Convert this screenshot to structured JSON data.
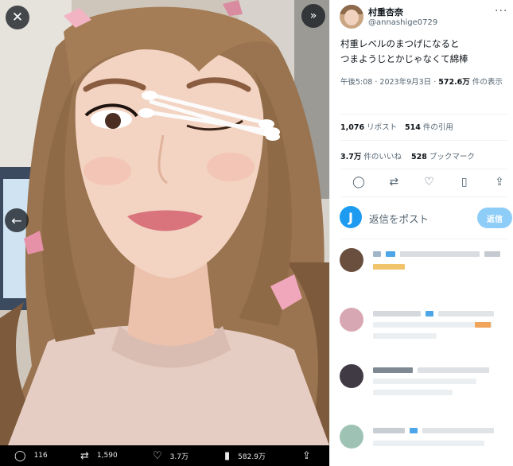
{
  "media": {
    "close_icon": "✕",
    "expand_icon": "»",
    "back_icon": "←",
    "actions": [
      {
        "icon": "reply-icon",
        "glyph": "💬",
        "count": "116"
      },
      {
        "icon": "retweet-icon",
        "glyph": "⇄",
        "count": "1,590"
      },
      {
        "icon": "heart-icon",
        "glyph": "♡",
        "count": "3.7万"
      },
      {
        "icon": "views-icon",
        "glyph": "▮",
        "count": "582.9万"
      },
      {
        "icon": "share-icon",
        "glyph": "⇪",
        "count": ""
      }
    ]
  },
  "tweet": {
    "display_name": "村重杏奈",
    "handle": "@annashige0729",
    "more_glyph": "···",
    "text_line1": "村重レベルのまつげになると",
    "text_line2": "つまようじとかじゃなくて綿棒",
    "time": "午後5:08",
    "sep": " · ",
    "date": "2023年9月3日",
    "views_count": "572.6万",
    "views_label": " 件の表示",
    "reposts_count": "1,076",
    "reposts_label": " リポスト",
    "quotes_count": "514",
    "quotes_label": " 件の引用",
    "likes_count": "3.7万",
    "likes_label": " 件のいいね",
    "bookmarks_count": "528",
    "bookmarks_label": " ブックマーク"
  },
  "action_bar": [
    {
      "name": "reply-icon",
      "glyph": "◯"
    },
    {
      "name": "retweet-icon",
      "glyph": "⇄"
    },
    {
      "name": "heart-icon",
      "glyph": "♡"
    },
    {
      "name": "bookmark-icon",
      "glyph": "▯"
    },
    {
      "name": "share-icon",
      "glyph": "⇪"
    }
  ],
  "reply_box": {
    "avatar_letter": "J",
    "placeholder": "返信をポスト",
    "button_label": "返信"
  },
  "colors": {
    "accent": "#1d9bf0",
    "reply_button_disabled": "#8ecdf8",
    "secondary_text": "#536471"
  }
}
